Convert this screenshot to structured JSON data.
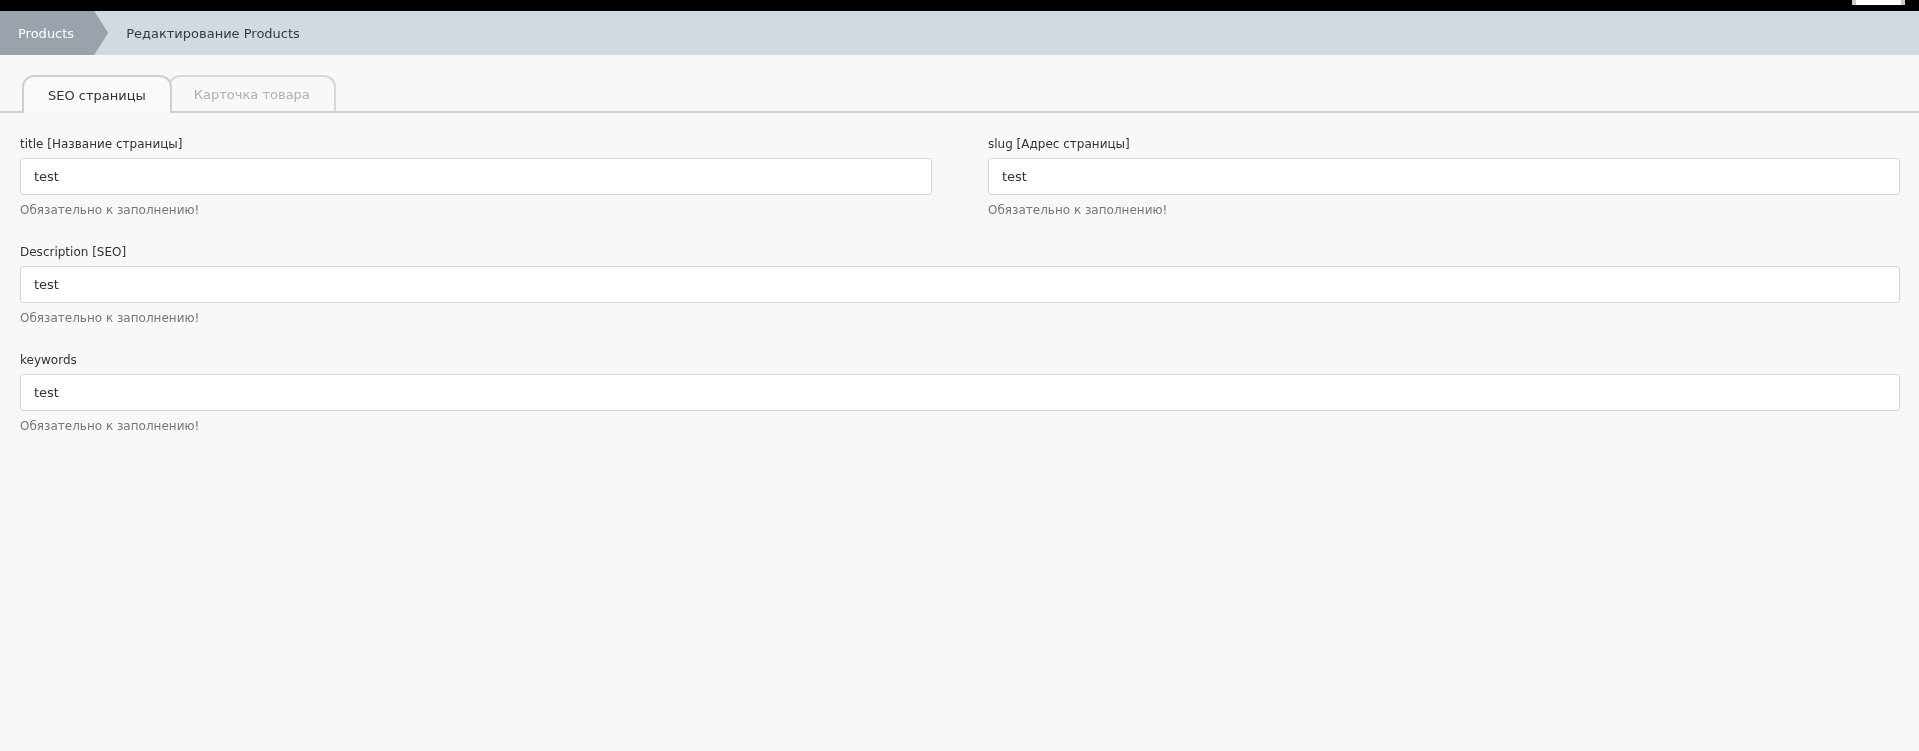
{
  "breadcrumb": [
    {
      "label": "Products",
      "selected": true
    },
    {
      "label": "Редактирование Products",
      "selected": false
    }
  ],
  "tabs": [
    {
      "label": "SEO страницы",
      "selected": true
    },
    {
      "label": "Карточка товара",
      "selected": false
    }
  ],
  "fields": [
    {
      "kind": "half",
      "label": "title [Название страницы]",
      "value": "test",
      "hint": "Обязательно к заполнению!"
    },
    {
      "kind": "half",
      "label": "slug [Адрес страницы]",
      "value": "test",
      "hint": "Обязательно к заполнению!"
    },
    {
      "kind": "full",
      "label": "Description [SEO]",
      "value": "test",
      "hint": "Обязательно к заполнению!"
    },
    {
      "kind": "full",
      "label": "keywords",
      "value": "test",
      "hint": "Обязательно к заполнению!"
    }
  ]
}
